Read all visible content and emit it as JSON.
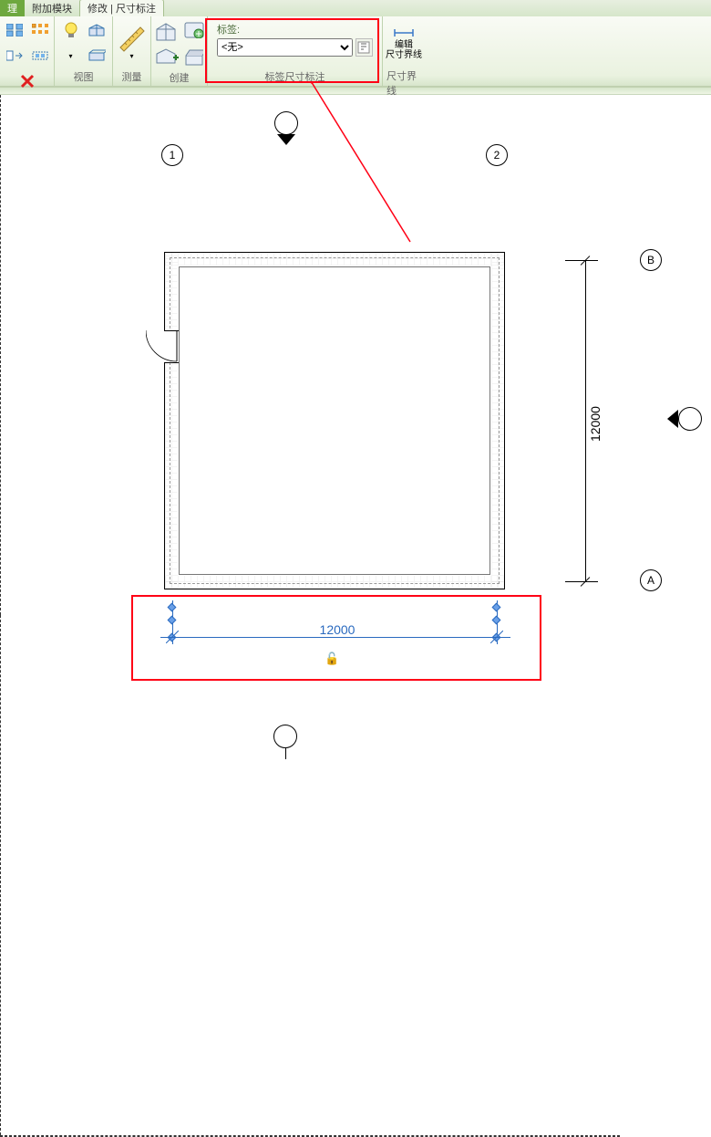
{
  "tabs": {
    "tab0_truncated": "理",
    "tab1": "附加模块",
    "tab2": "修改 | 尺寸标注"
  },
  "ribbon": {
    "collapse_glyph": "⏷",
    "panels": {
      "basic": "",
      "view": "视图",
      "measure": "测量",
      "create": "创建",
      "label_dim": "标签尺寸标注",
      "witness": "尺寸界线"
    },
    "label": {
      "caption": "标签:",
      "selected": "<无>"
    },
    "witness_btn": {
      "line1": "编辑",
      "line2": "尺寸界线"
    }
  },
  "drawing": {
    "grids": {
      "g1": "1",
      "g2": "2",
      "gA": "A",
      "gB": "B"
    },
    "dim_right": "12000",
    "dim_bottom": "12000",
    "lock_glyph": "🔓"
  }
}
